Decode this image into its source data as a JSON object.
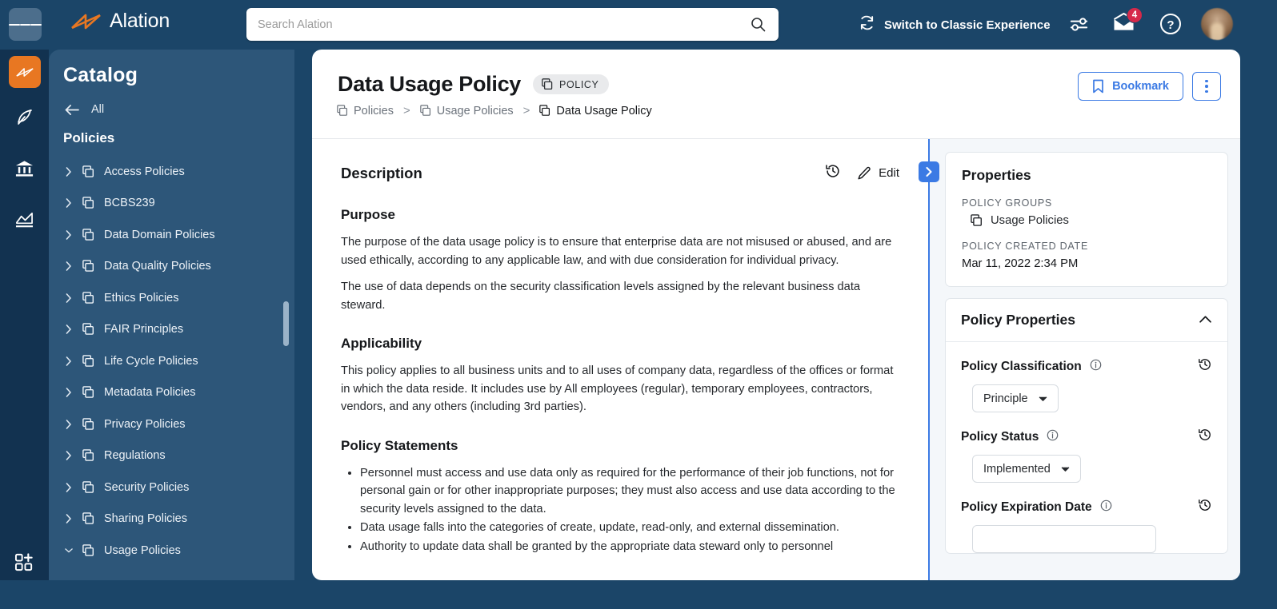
{
  "topbar": {
    "brand": "Alation",
    "search": {
      "placeholder": "Search Alation",
      "value": ""
    },
    "switch_label": "Switch to Classic Experience",
    "mail_badge": "4"
  },
  "sidebar": {
    "title": "Catalog",
    "back_label": "All",
    "section_label": "Policies",
    "items": [
      {
        "label": "Access Policies",
        "expanded": false
      },
      {
        "label": "BCBS239",
        "expanded": false
      },
      {
        "label": "Data Domain Policies",
        "expanded": false
      },
      {
        "label": "Data Quality Policies",
        "expanded": false
      },
      {
        "label": "Ethics Policies",
        "expanded": false
      },
      {
        "label": "FAIR Principles",
        "expanded": false
      },
      {
        "label": "Life Cycle Policies",
        "expanded": false
      },
      {
        "label": "Metadata Policies",
        "expanded": false
      },
      {
        "label": "Privacy Policies",
        "expanded": false
      },
      {
        "label": "Regulations",
        "expanded": false
      },
      {
        "label": "Security Policies",
        "expanded": false
      },
      {
        "label": "Sharing Policies",
        "expanded": false
      },
      {
        "label": "Usage Policies",
        "expanded": true
      }
    ]
  },
  "page": {
    "title": "Data Usage Policy",
    "type_badge": "POLICY",
    "breadcrumb": [
      "Policies",
      "Usage Policies",
      "Data Usage Policy"
    ],
    "bookmark_label": "Bookmark"
  },
  "description": {
    "heading": "Description",
    "edit_label": "Edit",
    "purpose_heading": "Purpose",
    "purpose_p1": "The purpose of the data usage policy is to ensure that enterprise data are not misused or abused, and are used ethically, according to any applicable law, and with due consideration for individual privacy.",
    "purpose_p2": "The use of data depends on the security classification levels assigned by the relevant business data steward.",
    "applicability_heading": "Applicability",
    "applicability_p1": "This policy applies to all business units and to all uses of company data, regardless of the offices or format in which the data reside.  It includes use by All employees (regular), temporary employees, contractors, vendors, and any others (including 3rd parties).",
    "statements_heading": "Policy Statements",
    "statements": [
      "Personnel must access and use data only as required for the performance of their job functions, not for personal gain or for other inappropriate purposes; they must also access and use data according to the security levels assigned to the data.",
      "Data usage falls into the categories of create, update, read-only, and external dissemination.",
      "Authority to update data shall be granted by the appropriate data steward only to personnel"
    ]
  },
  "properties": {
    "heading": "Properties",
    "policy_groups_label": "POLICY GROUPS",
    "policy_groups_value": "Usage Policies",
    "created_date_label": "POLICY CREATED DATE",
    "created_date_value": "Mar 11, 2022 2:34 PM"
  },
  "policy_properties": {
    "heading": "Policy Properties",
    "classification_label": "Policy Classification",
    "classification_value": "Principle",
    "status_label": "Policy Status",
    "status_value": "Implemented",
    "expiration_label": "Policy Expiration Date",
    "expiration_value": ""
  },
  "colors": {
    "brand_orange": "#e87722",
    "header_navy": "#1b4568",
    "rail_navy": "#123250",
    "sidebar_blue": "#2d5679",
    "accent_blue": "#3b7ae4",
    "badge_red": "#d6294a"
  }
}
